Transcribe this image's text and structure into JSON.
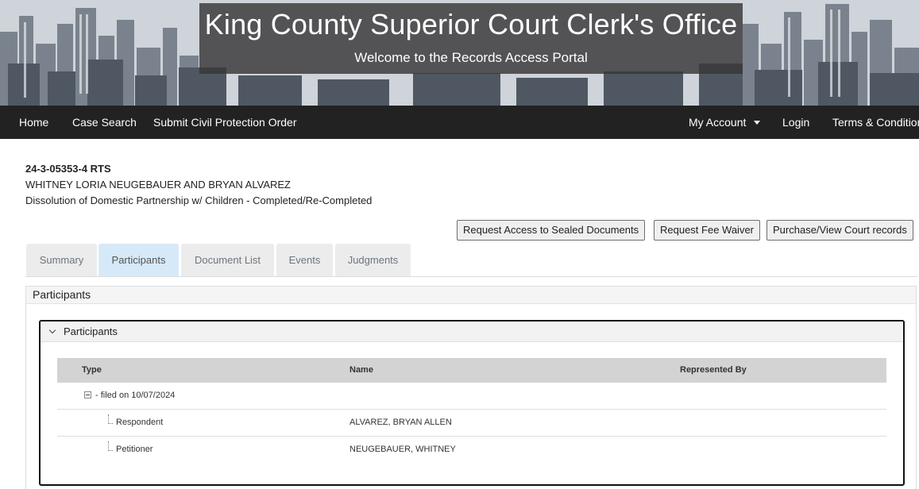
{
  "banner": {
    "title": "King County Superior Court Clerk's Office",
    "subtitle": "Welcome to the Records Access Portal"
  },
  "nav": {
    "home": "Home",
    "case_search": "Case Search",
    "submit_cpo": "Submit Civil Protection Order",
    "my_account": "My Account",
    "login": "Login",
    "terms": "Terms & Conditions"
  },
  "case": {
    "number": "24-3-05353-4 RTS",
    "parties": "WHITNEY LORIA NEUGEBAUER AND BRYAN ALVAREZ",
    "type": "Dissolution of Domestic Partnership w/ Children - Completed/Re-Completed"
  },
  "actions": {
    "request_sealed": "Request Access to Sealed Documents",
    "fee_waiver": "Request Fee Waiver",
    "purchase": "Purchase/View Court records"
  },
  "tabs": {
    "summary": "Summary",
    "participants": "Participants",
    "documents": "Document List",
    "events": "Events",
    "judgments": "Judgments",
    "active": "participants"
  },
  "panel": {
    "title": "Participants",
    "section_title": "Participants",
    "columns": {
      "type": "Type",
      "name": "Name",
      "represented_by": "Represented By"
    },
    "group": "- filed on 10/07/2024",
    "rows": [
      {
        "type": "Respondent",
        "name": "ALVAREZ, BRYAN ALLEN",
        "represented_by": ""
      },
      {
        "type": "Petitioner",
        "name": "NEUGEBAUER, WHITNEY",
        "represented_by": ""
      }
    ]
  }
}
